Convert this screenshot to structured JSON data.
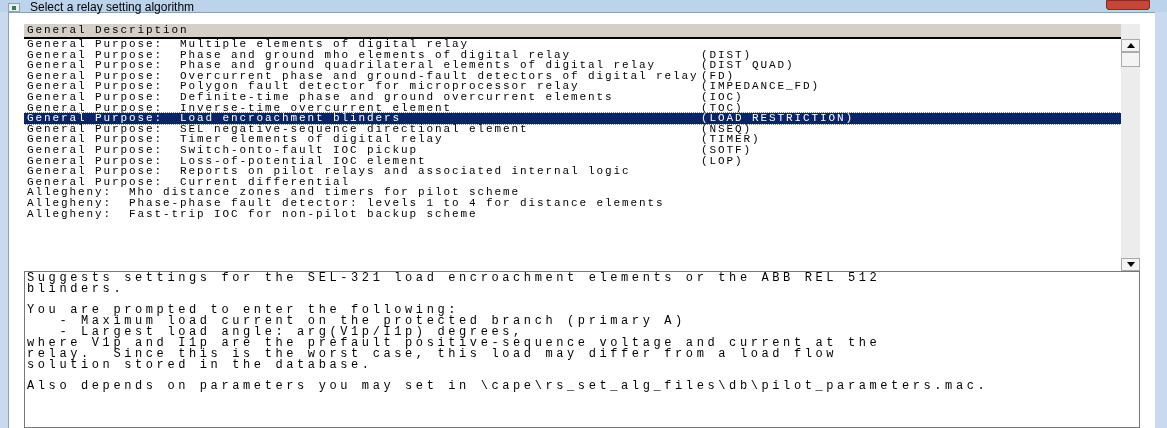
{
  "window": {
    "title": "Select a relay setting algorithm"
  },
  "list": {
    "header": "General Description",
    "rows": [
      {
        "description": "General Purpose:  Multiple elements of digital relay",
        "selected": false
      },
      {
        "description": "General Purpose:  Phase and ground mho elements of digital relay",
        "code": "(DIST)",
        "selected": false
      },
      {
        "description": "General Purpose:  Phase and ground quadrilateral elements of digital relay",
        "code": "(DIST QUAD)",
        "selected": false
      },
      {
        "description": "General Purpose:  Overcurrent phase and ground-fault detectors of digital relay",
        "code": "(FD)",
        "selected": false
      },
      {
        "description": "General Purpose:  Polygon fault detector for microprocessor relay",
        "code": "(IMPEDANCE_FD)",
        "selected": false
      },
      {
        "description": "General Purpose:  Definite-time phase and ground overcurrent elements",
        "code": "(IOC)",
        "selected": false
      },
      {
        "description": "General Purpose:  Inverse-time overcurrent element",
        "code": "(TOC)",
        "selected": false
      },
      {
        "description": "General Purpose:  Load encroachment blinders",
        "code": "(LOAD RESTRICTION)",
        "selected": true
      },
      {
        "description": "General Purpose:  SEL negative-sequence directional element",
        "code": "(NSEQ)",
        "selected": false
      },
      {
        "description": "General Purpose:  Timer elements of digital relay",
        "code": "(TIMER)",
        "selected": false
      },
      {
        "description": "General Purpose:  Switch-onto-fault IOC pickup",
        "code": "(SOTF)",
        "selected": false
      },
      {
        "description": "General Purpose:  Loss-of-potential IOC element",
        "code": "(LOP)",
        "selected": false
      },
      {
        "description": "General Purpose:  Reports on pilot relays and associated internal logic",
        "selected": false
      },
      {
        "description": "General Purpose:  Current differential",
        "selected": false
      },
      {
        "description": "Allegheny:  Mho distance zones and timers for pilot scheme",
        "selected": false
      },
      {
        "description": "Allegheny:  Phase-phase fault detector: levels 1 to 4 for distance elements",
        "selected": false
      },
      {
        "description": "Allegheny:  Fast-trip IOC for non-pilot backup scheme",
        "selected": false
      }
    ]
  },
  "details": {
    "paragraphs": [
      "Suggests settings for the SEL-321 load encroachment elements or the ABB REL 512\nblinders.",
      "You are prompted to enter the following:\n   - Maximum load current on the protected branch (primary A)\n   - Largest load angle: arg(V1p/I1p) degrees,\nwhere V1p and I1p are the prefault positive-sequence voltage and current at the\nrelay.  Since this is the worst case, this load may differ from a load flow\nsolution stored in the database.",
      "Also depends on parameters you may set in \\cape\\rs_set_alg_files\\db\\pilot_parameters.mac."
    ]
  }
}
